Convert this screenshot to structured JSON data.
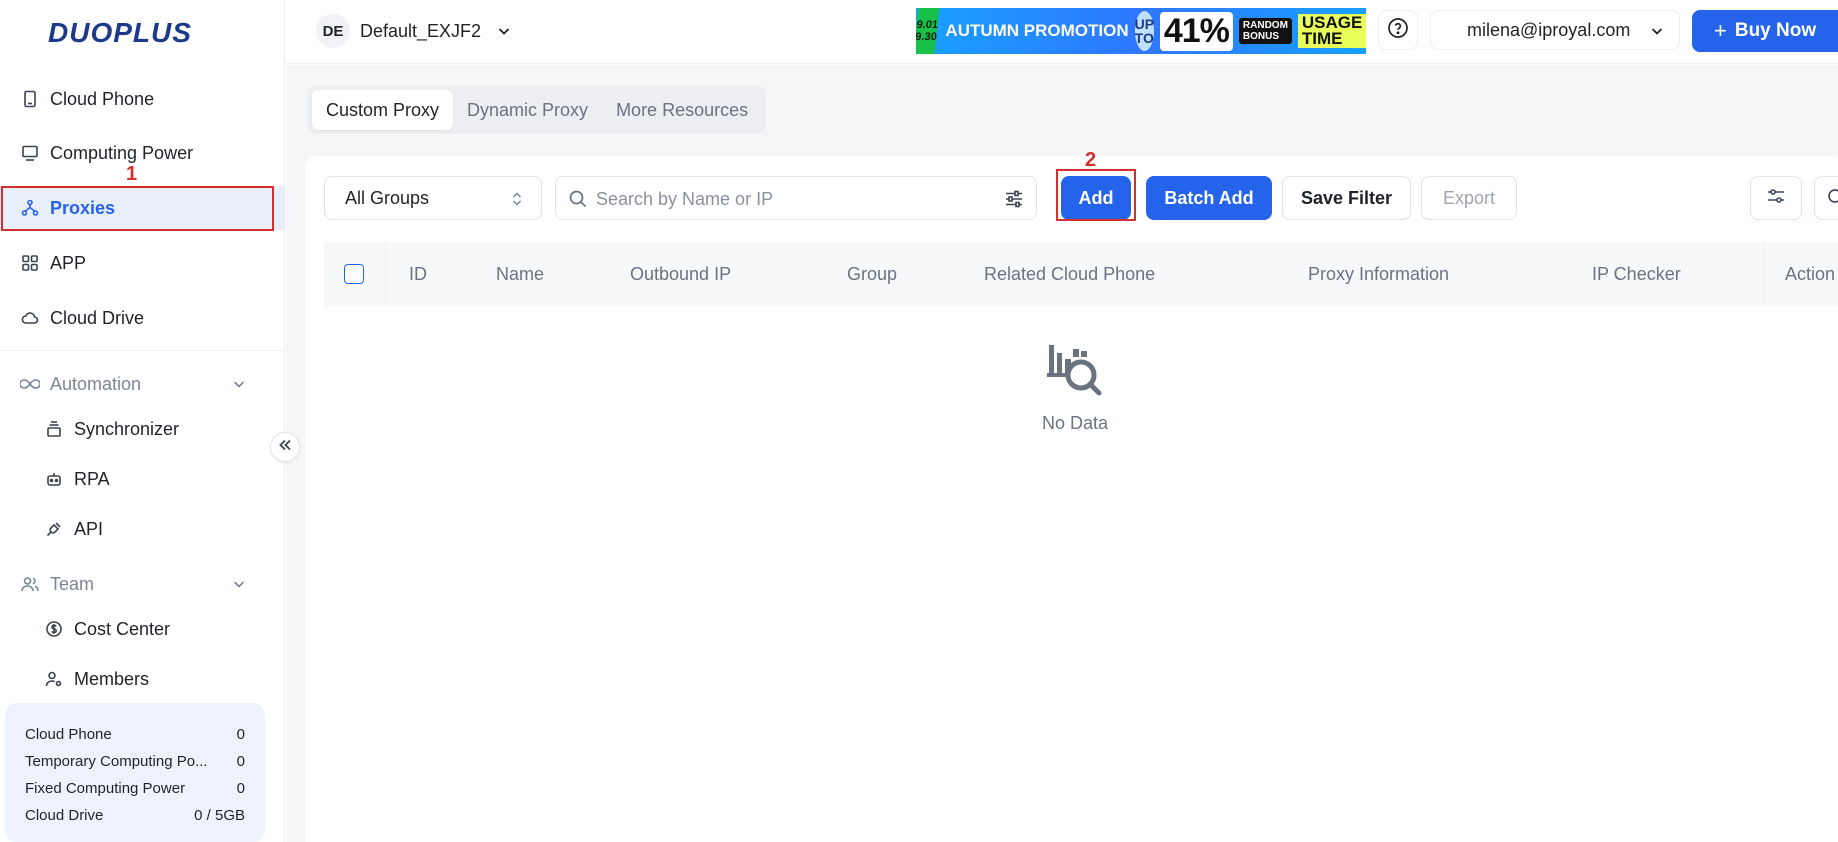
{
  "brand": {
    "logo": "DUOPLUS"
  },
  "sidebar": {
    "items": [
      {
        "label": "Cloud Phone",
        "icon": "phone-icon"
      },
      {
        "label": "Computing Power",
        "icon": "monitor-icon"
      },
      {
        "label": "Proxies",
        "icon": "network-icon",
        "active": true
      },
      {
        "label": "APP",
        "icon": "apps-grid-icon"
      },
      {
        "label": "Cloud Drive",
        "icon": "cloud-icon"
      }
    ],
    "automation": {
      "label": "Automation",
      "items": [
        {
          "label": "Synchronizer"
        },
        {
          "label": "RPA"
        },
        {
          "label": "API"
        }
      ]
    },
    "team": {
      "label": "Team",
      "items": [
        {
          "label": "Cost Center"
        },
        {
          "label": "Members"
        }
      ]
    },
    "usage": [
      {
        "label": "Cloud Phone",
        "value": "0"
      },
      {
        "label": "Temporary Computing Po...",
        "value": "0"
      },
      {
        "label": "Fixed Computing Power",
        "value": "0"
      },
      {
        "label": "Cloud Drive",
        "value": "0 / 5GB"
      }
    ]
  },
  "annotations": {
    "one": "1",
    "two": "2"
  },
  "header": {
    "workspace_badge": "DE",
    "workspace_name": "Default_EXJF2",
    "promo": {
      "date_top": "9.01",
      "date_bottom": "9.30",
      "title": "AUTUMN PROMOTION",
      "upto": "UP TO",
      "percent": "41%",
      "bonus": "RANDOM BONUS",
      "usage": "USAGE TIME"
    },
    "account": "milena@iproyal.com",
    "buy_label": "Buy Now"
  },
  "tabs": [
    {
      "label": "Custom Proxy",
      "active": true
    },
    {
      "label": "Dynamic Proxy"
    },
    {
      "label": "More Resources"
    }
  ],
  "toolbar": {
    "group_select": "All Groups",
    "search_placeholder": "Search by Name or IP",
    "add_label": "Add",
    "batch_add_label": "Batch Add",
    "save_filter_label": "Save Filter",
    "export_label": "Export"
  },
  "table": {
    "columns": [
      "ID",
      "Name",
      "Outbound IP",
      "Group",
      "Related Cloud Phone",
      "Proxy Information",
      "IP Checker",
      "Action"
    ],
    "empty_text": "No Data"
  },
  "colors": {
    "primary": "#2563eb",
    "annotation": "#d32f2f"
  }
}
